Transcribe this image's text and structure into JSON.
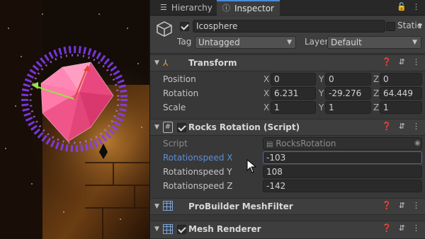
{
  "tabs": {
    "hierarchy": "Hierarchy",
    "inspector": "Inspector"
  },
  "gameobject": {
    "active": true,
    "name": "Icosphere",
    "static_label": "Static",
    "tag_label": "Tag",
    "tag_value": "Untagged",
    "layer_label": "Layer",
    "layer_value": "Default"
  },
  "transform": {
    "title": "Transform",
    "position": {
      "label": "Position",
      "x": "0",
      "y": "0",
      "z": "0"
    },
    "rotation": {
      "label": "Rotation",
      "x": "6.231",
      "y": "-29.276",
      "z": "64.449"
    },
    "scale": {
      "label": "Scale",
      "x": "1",
      "y": "1",
      "z": "1"
    }
  },
  "axes": {
    "x": "X",
    "y": "Y",
    "z": "Z"
  },
  "rocks_rotation": {
    "title": "Rocks Rotation (Script)",
    "enabled": true,
    "script_label": "Script",
    "script_value": "RocksRotation",
    "speed_x_label": "Rotationspeed X",
    "speed_x": "-103",
    "speed_y_label": "Rotationspeed Y",
    "speed_y": "108",
    "speed_z_label": "Rotationspeed Z",
    "speed_z": "-142"
  },
  "probuilder": {
    "title": "ProBuilder MeshFilter"
  },
  "mesh_renderer": {
    "title": "Mesh Renderer",
    "enabled": true
  },
  "colors": {
    "accent": "#4a8cd6",
    "highlight_label": "#5b8fd8",
    "panel": "#383838"
  }
}
